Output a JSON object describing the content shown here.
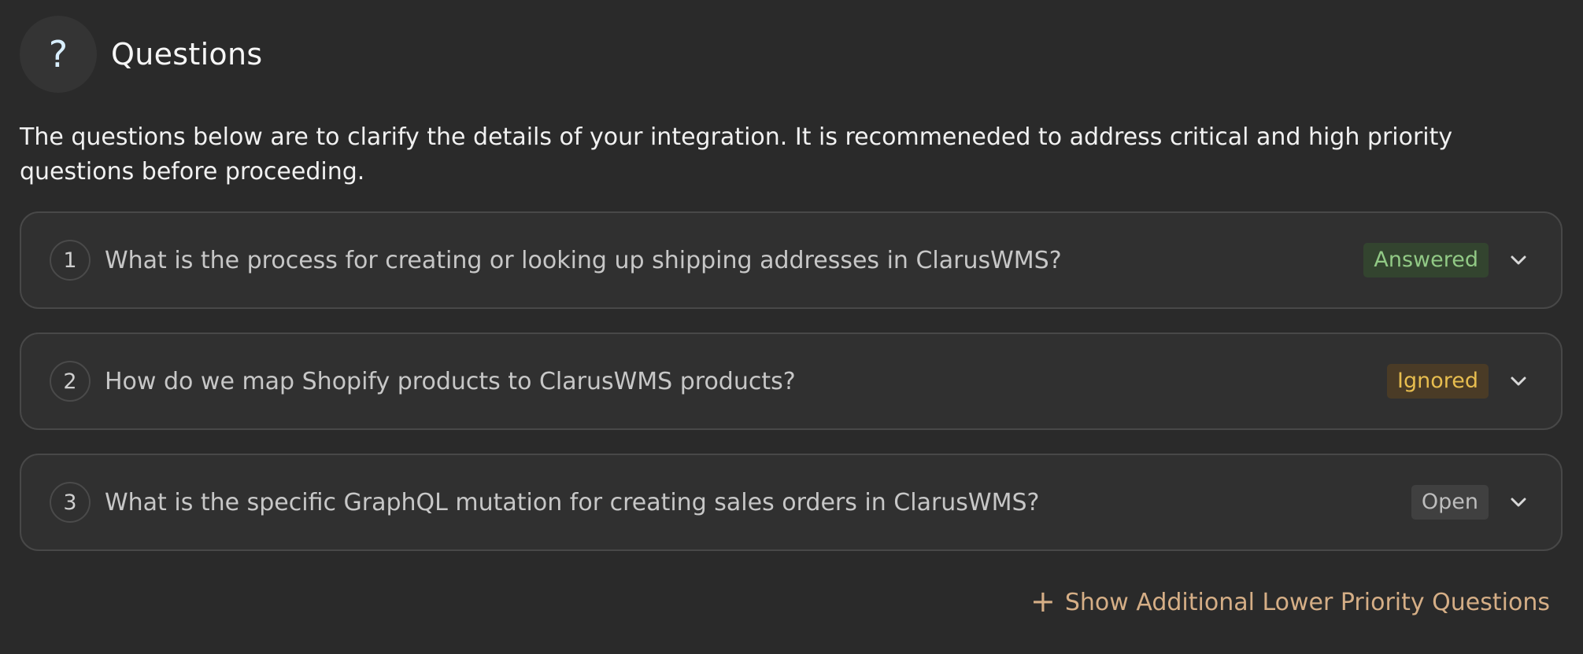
{
  "header": {
    "icon": "question-mark-icon",
    "icon_glyph": "?",
    "title": "Questions"
  },
  "intro": {
    "text": "The questions below are to clarify the details of your integration. It is recommeneded to address critical and high priority questions before proceeding."
  },
  "questions": [
    {
      "number": "1",
      "text": "What is the process for creating or looking up shipping addresses in ClarusWMS?",
      "status": "Answered",
      "status_color": "#91c985"
    },
    {
      "number": "2",
      "text": "How do we map Shopify products to ClarusWMS products?",
      "status": "Ignored",
      "status_color": "#e7bd4f"
    },
    {
      "number": "3",
      "text": "What is the specific GraphQL mutation for creating sales orders in ClarusWMS?",
      "status": "Open",
      "status_color": "#bdbdbd"
    }
  ],
  "footer": {
    "show_more_icon": "plus-icon",
    "show_more_glyph": "+",
    "show_more_label": "Show Additional Lower Priority Questions",
    "accent_color": "#d5ae86"
  }
}
